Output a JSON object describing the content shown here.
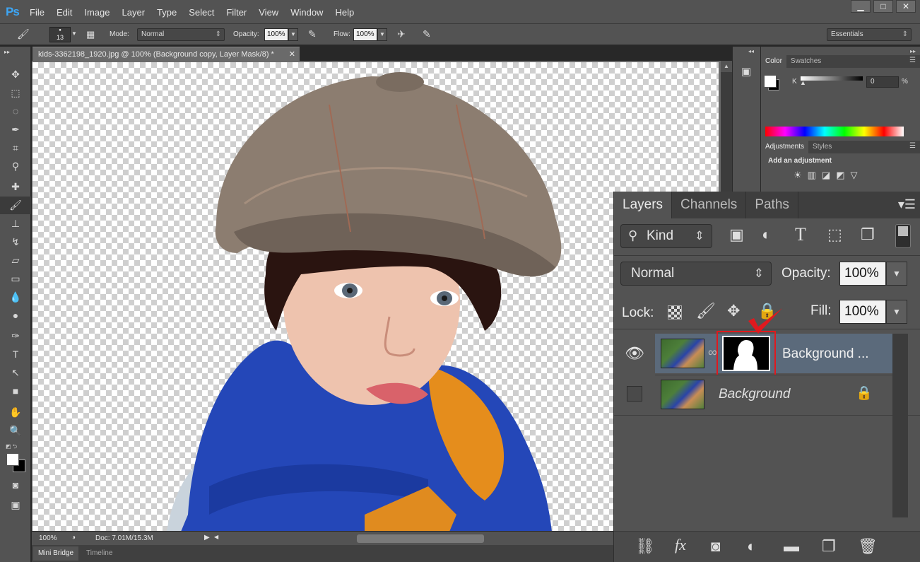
{
  "app": {
    "logo": "Ps"
  },
  "menu": [
    "File",
    "Edit",
    "Image",
    "Layer",
    "Type",
    "Select",
    "Filter",
    "View",
    "Window",
    "Help"
  ],
  "window_controls": [
    "▁",
    "□",
    "✕"
  ],
  "options": {
    "brush_size": "13",
    "mode_label": "Mode:",
    "mode_value": "Normal",
    "opacity_label": "Opacity:",
    "opacity_value": "100%",
    "flow_label": "Flow:",
    "flow_value": "100%",
    "workspace": "Essentials"
  },
  "document": {
    "tab_title": "kids-3362198_1920.jpg @ 100% (Background copy, Layer Mask/8) *",
    "close": "✕",
    "zoom": "100%",
    "doc_info": "Doc: 7.01M/15.3M"
  },
  "bottom_tabs": [
    "Mini Bridge",
    "Timeline"
  ],
  "color_panel": {
    "tabs": [
      "Color",
      "Swatches"
    ],
    "channel": "K",
    "value": "0",
    "unit": "%"
  },
  "adjustments_panel": {
    "tabs": [
      "Adjustments",
      "Styles"
    ],
    "title": "Add an adjustment"
  },
  "layers_panel": {
    "tabs": [
      "Layers",
      "Channels",
      "Paths"
    ],
    "filter": "Kind",
    "blend_mode": "Normal",
    "opacity_label": "Opacity:",
    "opacity_value": "100%",
    "lock_label": "Lock:",
    "fill_label": "Fill:",
    "fill_value": "100%",
    "layers": [
      {
        "name": "Background ...",
        "visible": true,
        "selected": true,
        "has_mask": true
      },
      {
        "name": "Background",
        "visible": false,
        "selected": false,
        "locked": true
      }
    ]
  },
  "colors": {
    "accent": "#3da6f5",
    "highlight": "#e0191e",
    "selected_row": "#5b6a7b"
  }
}
